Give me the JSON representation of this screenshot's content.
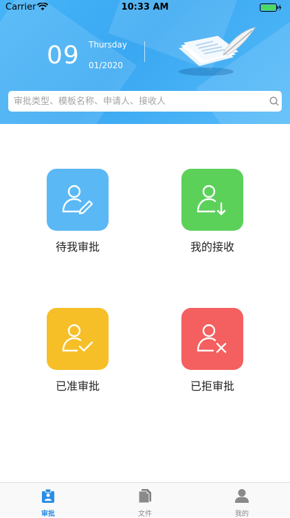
{
  "status_bar": {
    "carrier": "Carrier",
    "time": "10:33 AM"
  },
  "header": {
    "day": "09",
    "weekday": "Thursday",
    "month_year": "01/2020"
  },
  "search": {
    "placeholder": "审批类型、模板名称、申请人、接收人"
  },
  "tiles": [
    {
      "label": "待我审批",
      "color": "#5ab8f5",
      "icon": "user-edit-icon"
    },
    {
      "label": "我的接收",
      "color": "#5cd15a",
      "icon": "user-download-icon"
    },
    {
      "label": "已准审批",
      "color": "#f6bf27",
      "icon": "user-check-icon"
    },
    {
      "label": "已拒审批",
      "color": "#f45f5f",
      "icon": "user-reject-icon"
    }
  ],
  "tabbar": {
    "tabs": [
      {
        "label": "审批",
        "active": true,
        "icon": "approval-icon"
      },
      {
        "label": "文件",
        "active": false,
        "icon": "file-icon"
      },
      {
        "label": "我的",
        "active": false,
        "icon": "profile-icon"
      }
    ]
  },
  "colors": {
    "header_blue": "#46b4f7",
    "active_tab": "#2a8ee6"
  }
}
